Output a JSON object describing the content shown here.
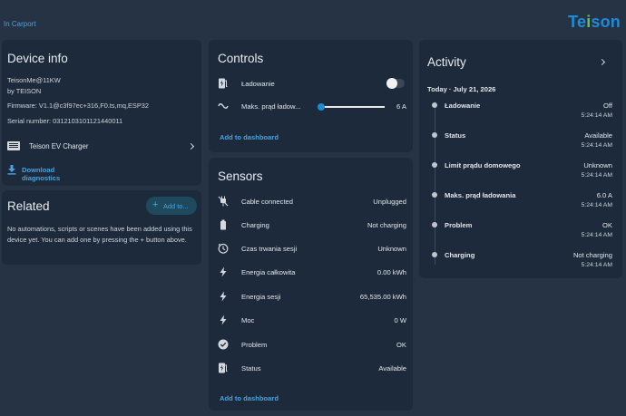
{
  "breadcrumb": "In Carport",
  "logo": {
    "text_a": "Te",
    "text_dot": "i",
    "text_b": "son"
  },
  "device_info": {
    "title": "Device info",
    "model": "TeisonMe@11KW",
    "manufacturer": "by TEISON",
    "firmware": "Firmware: V1.1@c3f97ec+316,F0.ts,mq,ESP32",
    "serial": "Serial number: 0312103101121440011",
    "charger_label": "Teison EV Charger",
    "download_label": "Download diagnostics"
  },
  "related": {
    "title": "Related",
    "add_label": "Add to...",
    "text": "No automations, scripts or scenes have been added using this device yet. You can add one by pressing the + button above."
  },
  "controls": {
    "title": "Controls",
    "items": [
      {
        "icon": "ev-station-icon",
        "label": "Ładowanie",
        "state": "off"
      },
      {
        "icon": "current-ac-icon",
        "label": "Maks. prąd ładow...",
        "value": "6 A",
        "slider_fraction": 0.0
      }
    ],
    "add_label": "Add to dashboard"
  },
  "sensors": {
    "title": "Sensors",
    "items": [
      {
        "icon": "power-plug-off-icon",
        "label": "Cable connected",
        "value": "Unplugged"
      },
      {
        "icon": "battery-icon",
        "label": "Charging",
        "value": "Not charging"
      },
      {
        "icon": "timer-icon",
        "label": "Czas trwania sesji",
        "value": "Unknown"
      },
      {
        "icon": "flash-icon",
        "label": "Energia całkowita",
        "value": "0.00 kWh"
      },
      {
        "icon": "flash-icon",
        "label": "Energia sesji",
        "value": "65,535.00 kWh"
      },
      {
        "icon": "flash-icon",
        "label": "Moc",
        "value": "0 W"
      },
      {
        "icon": "check-circle-icon",
        "label": "Problem",
        "value": "OK"
      },
      {
        "icon": "ev-station-icon",
        "label": "Status",
        "value": "Available"
      }
    ],
    "add_label": "Add to dashboard"
  },
  "activity": {
    "title": "Activity",
    "date": "Today · July 21, 2026",
    "events": [
      {
        "name": "Ładowanie",
        "state": "Off",
        "time": "5:24:14 AM"
      },
      {
        "name": "Status",
        "state": "Available",
        "time": "5:24:14 AM"
      },
      {
        "name": "Limit prądu domowego",
        "state": "Unknown",
        "time": "5:24:14 AM"
      },
      {
        "name": "Maks. prąd ładowania",
        "state": "6.0 A",
        "time": "5:24:14 AM"
      },
      {
        "name": "Problem",
        "state": "OK",
        "time": "5:24:14 AM"
      },
      {
        "name": "Charging",
        "state": "Not charging",
        "time": "5:24:14 AM"
      }
    ]
  },
  "colors": {
    "background": "#253345",
    "card": "#1c2a3b",
    "accent": "#4aa3df",
    "slider": "#1f8ad6"
  }
}
